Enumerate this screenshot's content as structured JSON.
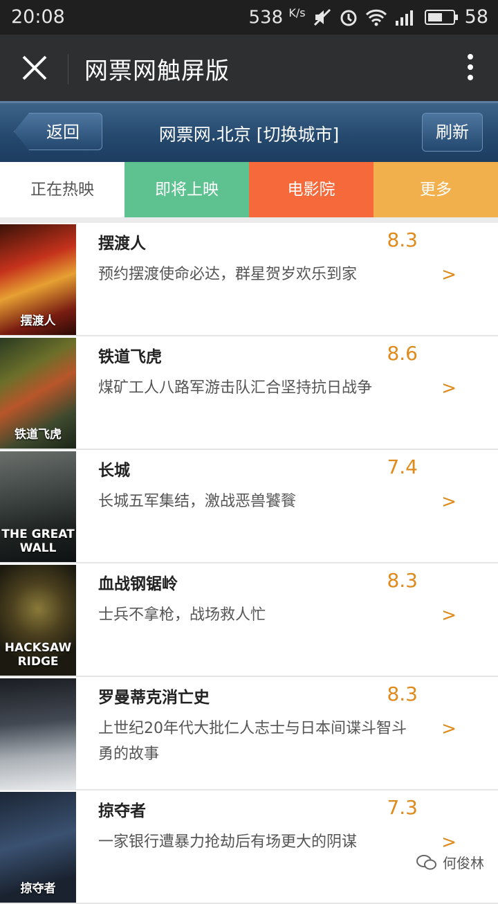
{
  "status_bar": {
    "time": "20:08",
    "speed": "538",
    "speed_unit": "K/s",
    "battery": "58",
    "icons": [
      "mute-icon",
      "alarm-icon",
      "wifi-icon",
      "signal-icon",
      "battery-icon"
    ]
  },
  "titlebar": {
    "title": "网票网触屏版"
  },
  "site_header": {
    "back_label": "返回",
    "title": "网票网.北京 [切换城市]",
    "refresh_label": "刷新"
  },
  "tabs": [
    {
      "label": "正在热映"
    },
    {
      "label": "即将上映"
    },
    {
      "label": "电影院"
    },
    {
      "label": "更多"
    }
  ],
  "movies": [
    {
      "name": "摆渡人",
      "score": "8.3",
      "desc": "预约摆渡使命必达，群星贺岁欢乐到家",
      "poster_text": "摆渡人",
      "arrow": ">"
    },
    {
      "name": "铁道飞虎",
      "score": "8.6",
      "desc": "煤矿工人八路军游击队汇合坚持抗日战争",
      "poster_text": "铁道飞虎",
      "arrow": ">"
    },
    {
      "name": "长城",
      "score": "7.4",
      "desc": "长城五军集结，激战恶兽饕餮",
      "poster_text": "THE GREAT WALL",
      "arrow": ">"
    },
    {
      "name": "血战钢锯岭",
      "score": "8.3",
      "desc": "士兵不拿枪，战场救人忙",
      "poster_text": "HACKSAW RIDGE",
      "arrow": ">"
    },
    {
      "name": "罗曼蒂克消亡史",
      "score": "8.3",
      "desc": "上世纪20年代大批仁人志士与日本间谍斗智斗勇的故事",
      "poster_text": "",
      "arrow": ">"
    },
    {
      "name": "掠夺者",
      "score": "7.3",
      "desc": "一家银行遭暴力抢劫后有场更大的阴谋",
      "poster_text": "掠夺者",
      "arrow": ">"
    }
  ],
  "watermark": {
    "text": "何俊林"
  }
}
